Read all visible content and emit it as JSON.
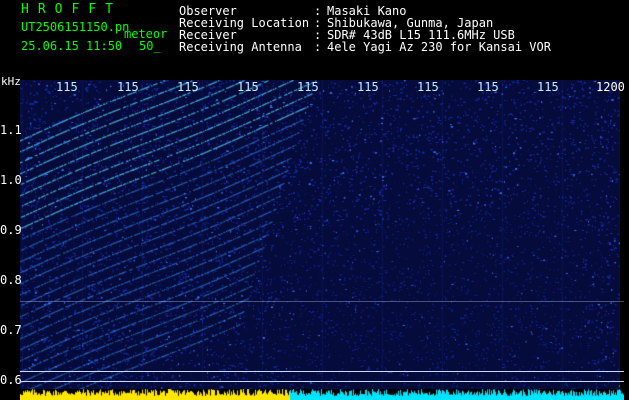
{
  "header": {
    "brand": "HROFFT",
    "filename": "UT2506151150.pn",
    "mode": "meteor",
    "date_time": "25.06.15 11:50",
    "rate": "50_",
    "observer_label": "Observer",
    "observer_sep": ":",
    "observer_value": "Masaki Kano",
    "location_label": "Receiving Location",
    "location_sep": ":",
    "location_value": "Shibukawa, Gunma, Japan",
    "receiver_label": "Receiver",
    "receiver_sep": ":",
    "receiver_value": "SDR# 43dB L15 111.6MHz USB",
    "antenna_label": "Receiving Antenna",
    "antenna_sep": ":",
    "antenna_value": "4ele Yagi Az 230 for Kansai VOR"
  },
  "axis": {
    "unit": "kHz",
    "y_ticks": [
      "1.1",
      "1.0",
      "0.9",
      "0.8",
      "0.7",
      "0.6"
    ],
    "x_ticks": [
      "115",
      "115",
      "115",
      "115",
      "115",
      "115",
      "115",
      "115",
      "115",
      "1200"
    ]
  },
  "colors": {
    "background": "#000000",
    "header_text": "#ffffff",
    "brand_text": "#00ff00",
    "tick_text": "#ffffff",
    "noise": "#1a2a9a",
    "trace": "#39c8ff",
    "power_low": "#ffe600",
    "power_high": "#00e5ff"
  }
}
